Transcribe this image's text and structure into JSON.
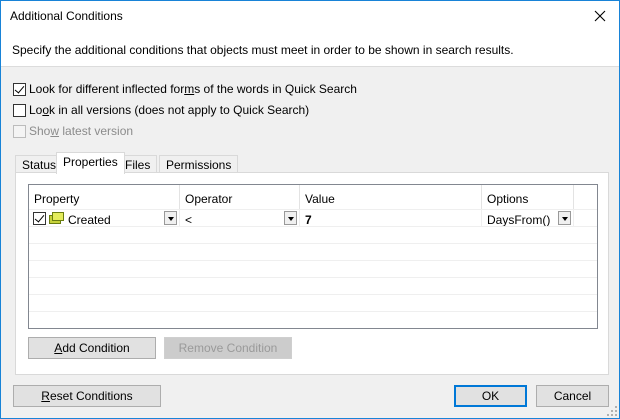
{
  "window": {
    "title": "Additional Conditions"
  },
  "description": "Specify the additional conditions that objects must meet in order to be shown in search results.",
  "options": {
    "inflected": {
      "pre": "Look for different inflected for",
      "key": "m",
      "post": "s of the words in Quick Search",
      "checked": true
    },
    "all_versions": {
      "pre": "Lo",
      "key": "o",
      "post": "k in all versions (does not apply to Quick Search)",
      "checked": false
    },
    "latest": {
      "pre": "Sho",
      "key": "w",
      "post": " latest version",
      "checked": false,
      "disabled": true
    }
  },
  "tabs": [
    "Status",
    "Properties",
    "Files",
    "Permissions"
  ],
  "active_tab": "Properties",
  "grid": {
    "columns": [
      "Property",
      "Operator",
      "Value",
      "Options"
    ],
    "rows": [
      {
        "checked": true,
        "icon": "property-icon",
        "property": "Created",
        "operator": "<",
        "value": "7",
        "options": "DaysFrom()"
      }
    ]
  },
  "buttons": {
    "add": {
      "key": "A",
      "rest": "dd Condition"
    },
    "remove": "Remove Condition",
    "reset": {
      "key": "R",
      "rest": "eset Conditions"
    },
    "ok": "OK",
    "cancel": "Cancel"
  },
  "colors": {
    "accent": "#0078d7",
    "border": "#1883d7"
  }
}
